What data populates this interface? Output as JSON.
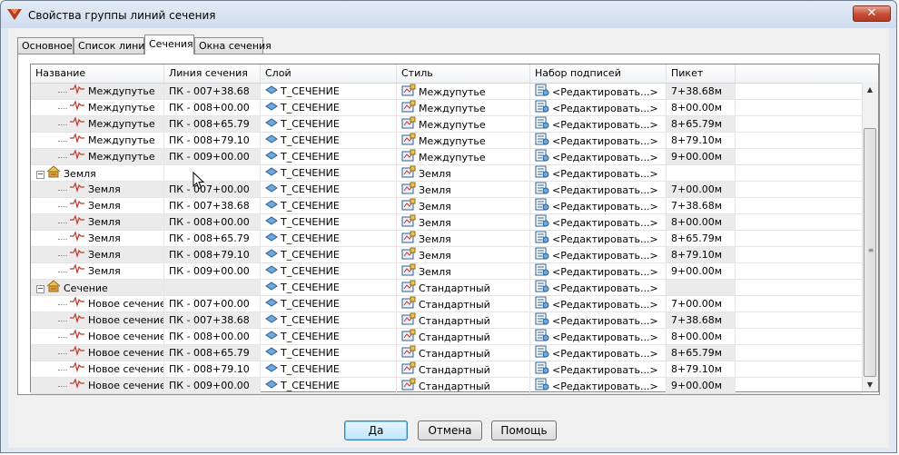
{
  "window": {
    "title": "Свойства группы линий сечения",
    "close_label": "✕"
  },
  "tabs": [
    {
      "label": "Основное"
    },
    {
      "label": "Список линий"
    },
    {
      "label": "Сечения"
    },
    {
      "label": "Окна сечения"
    }
  ],
  "active_tab": 2,
  "table": {
    "columns": [
      "Название",
      "Линия сечения",
      "Слой",
      "Стиль",
      "Набор подписей",
      "Пикет"
    ],
    "rows": [
      {
        "level": 2,
        "type": "section",
        "name": "Междупутье",
        "line": "ПК - 007+38.68",
        "layer": "Т_СЕЧЕНИЕ",
        "style": "Междупутье",
        "labels": "<Редактировать...>",
        "picket": "7+38.68м"
      },
      {
        "level": 2,
        "type": "section",
        "name": "Междупутье",
        "line": "ПК - 008+00.00",
        "layer": "Т_СЕЧЕНИЕ",
        "style": "Междупутье",
        "labels": "<Редактировать...>",
        "picket": "8+00.00м"
      },
      {
        "level": 2,
        "type": "section",
        "name": "Междупутье",
        "line": "ПК - 008+65.79",
        "layer": "Т_СЕЧЕНИЕ",
        "style": "Междупутье",
        "labels": "<Редактировать...>",
        "picket": "8+65.79м"
      },
      {
        "level": 2,
        "type": "section",
        "name": "Междупутье",
        "line": "ПК - 008+79.10",
        "layer": "Т_СЕЧЕНИЕ",
        "style": "Междупутье",
        "labels": "<Редактировать...>",
        "picket": "8+79.10м"
      },
      {
        "level": 2,
        "type": "section",
        "name": "Междупутье",
        "line": "ПК - 009+00.00",
        "layer": "Т_СЕЧЕНИЕ",
        "style": "Междупутье",
        "labels": "<Редактировать...>",
        "picket": "9+00.00м"
      },
      {
        "level": 1,
        "type": "group",
        "name": "Земля",
        "line": "",
        "layer": "Т_СЕЧЕНИЕ",
        "style": "Земля",
        "labels": "<Редактировать...>",
        "picket": ""
      },
      {
        "level": 2,
        "type": "section",
        "name": "Земля",
        "line": "ПК - 007+00.00",
        "layer": "Т_СЕЧЕНИЕ",
        "style": "Земля",
        "labels": "<Редактировать...>",
        "picket": "7+00.00м"
      },
      {
        "level": 2,
        "type": "section",
        "name": "Земля",
        "line": "ПК - 007+38.68",
        "layer": "Т_СЕЧЕНИЕ",
        "style": "Земля",
        "labels": "<Редактировать...>",
        "picket": "7+38.68м"
      },
      {
        "level": 2,
        "type": "section",
        "name": "Земля",
        "line": "ПК - 008+00.00",
        "layer": "Т_СЕЧЕНИЕ",
        "style": "Земля",
        "labels": "<Редактировать...>",
        "picket": "8+00.00м"
      },
      {
        "level": 2,
        "type": "section",
        "name": "Земля",
        "line": "ПК - 008+65.79",
        "layer": "Т_СЕЧЕНИЕ",
        "style": "Земля",
        "labels": "<Редактировать...>",
        "picket": "8+65.79м"
      },
      {
        "level": 2,
        "type": "section",
        "name": "Земля",
        "line": "ПК - 008+79.10",
        "layer": "Т_СЕЧЕНИЕ",
        "style": "Земля",
        "labels": "<Редактировать...>",
        "picket": "8+79.10м"
      },
      {
        "level": 2,
        "type": "section",
        "name": "Земля",
        "line": "ПК - 009+00.00",
        "layer": "Т_СЕЧЕНИЕ",
        "style": "Земля",
        "labels": "<Редактировать...>",
        "picket": "9+00.00м"
      },
      {
        "level": 1,
        "type": "group",
        "name": "Сечение",
        "line": "",
        "layer": "Т_СЕЧЕНИЕ",
        "style": "Стандартный",
        "labels": "<Редактировать...>",
        "picket": ""
      },
      {
        "level": 2,
        "type": "section",
        "name": "Новое сечение",
        "line": "ПК - 007+00.00",
        "layer": "Т_СЕЧЕНИЕ",
        "style": "Стандартный",
        "labels": "<Редактировать...>",
        "picket": "7+00.00м"
      },
      {
        "level": 2,
        "type": "section",
        "name": "Новое сечение",
        "line": "ПК - 007+38.68",
        "layer": "Т_СЕЧЕНИЕ",
        "style": "Стандартный",
        "labels": "<Редактировать...>",
        "picket": "7+38.68м"
      },
      {
        "level": 2,
        "type": "section",
        "name": "Новое сечение",
        "line": "ПК - 008+00.00",
        "layer": "Т_СЕЧЕНИЕ",
        "style": "Стандартный",
        "labels": "<Редактировать...>",
        "picket": "8+00.00м"
      },
      {
        "level": 2,
        "type": "section",
        "name": "Новое сечение",
        "line": "ПК - 008+65.79",
        "layer": "Т_СЕЧЕНИЕ",
        "style": "Стандартный",
        "labels": "<Редактировать...>",
        "picket": "8+65.79м"
      },
      {
        "level": 2,
        "type": "section",
        "name": "Новое сечение",
        "line": "ПК - 008+79.10",
        "layer": "Т_СЕЧЕНИЕ",
        "style": "Стандартный",
        "labels": "<Редактировать...>",
        "picket": "8+79.10м"
      },
      {
        "level": 2,
        "type": "section",
        "name": "Новое сечение",
        "line": "ПК - 009+00.00",
        "layer": "Т_СЕЧЕНИЕ",
        "style": "Стандартный",
        "labels": "<Редактировать...>",
        "picket": "9+00.00м"
      }
    ]
  },
  "buttons": {
    "ok": "Да",
    "cancel": "Отмена",
    "help": "Помощь"
  },
  "colors": {
    "accent": "#3c7fb1",
    "row_shade": "#ebebeb",
    "close_red": "#c64d36"
  }
}
